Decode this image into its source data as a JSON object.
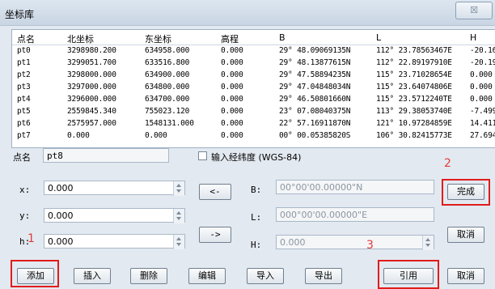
{
  "window": {
    "title": "坐标库",
    "close_symbol": "☒"
  },
  "table": {
    "headers": [
      "点名",
      "北坐标",
      "东坐标",
      "高程",
      "B",
      "L",
      "H"
    ],
    "rows": [
      [
        "pt0",
        "3298980.200",
        "634958.000",
        "0.000",
        "29° 48.09069135N",
        "112° 23.78563467E",
        "-20.16"
      ],
      [
        "pt1",
        "3299051.700",
        "633516.800",
        "0.000",
        "29° 48.13877615N",
        "112° 22.89197910E",
        "-20.19"
      ],
      [
        "pt2",
        "3298000.000",
        "634900.000",
        "0.000",
        "29° 47.58894235N",
        "115° 23.71028654E",
        "0.000"
      ],
      [
        "pt3",
        "3297000.000",
        "634800.000",
        "0.000",
        "29° 47.04848034N",
        "115° 23.64074806E",
        "0.000"
      ],
      [
        "pt4",
        "3296000.000",
        "634700.000",
        "0.000",
        "29° 46.50801660N",
        "115° 23.5712240TE",
        "0.000"
      ],
      [
        "pt5",
        "2559845.340",
        "755023.120",
        "0.000",
        "23° 07.08040375N",
        "113° 29.38053740E",
        "-7.499"
      ],
      [
        "pt6",
        "2575957.000",
        "1548131.000",
        "0.000",
        "22° 57.16911870N",
        "121° 10.97284859E",
        "14.411"
      ],
      [
        "pt7",
        "0.000",
        "0.000",
        "0.000",
        "00° 00.05385820S",
        "106° 30.82415773E",
        "27.694"
      ]
    ]
  },
  "form": {
    "point_name_label": "点名",
    "point_name_value": "pt8",
    "input_latlon_label": "输入经纬度 (WGS-84)",
    "x_label": "x:",
    "x_value": "0.000",
    "y_label": "y:",
    "y_value": "0.000",
    "h_label": "h:",
    "h_value": "0.000",
    "B_label": "B:",
    "B_value": "00°00'00.00000\"N",
    "L_label": "L:",
    "L_value": "000°00'00.00000\"E",
    "H_label": "H:",
    "H_value": "0.000",
    "to_left_label": "<-",
    "to_right_label": "->"
  },
  "buttons": {
    "done": "完成",
    "cancel_right": "取消",
    "add": "添加",
    "insert": "插入",
    "delete": "删除",
    "edit": "编辑",
    "import": "导入",
    "export": "导出",
    "reference": "引用",
    "cancel_bottom": "取消"
  },
  "annotations": {
    "one": "1",
    "two": "2",
    "three": "3"
  },
  "colors": {
    "highlight": "#e01c1c",
    "annotation_text": "#e33a3a"
  }
}
